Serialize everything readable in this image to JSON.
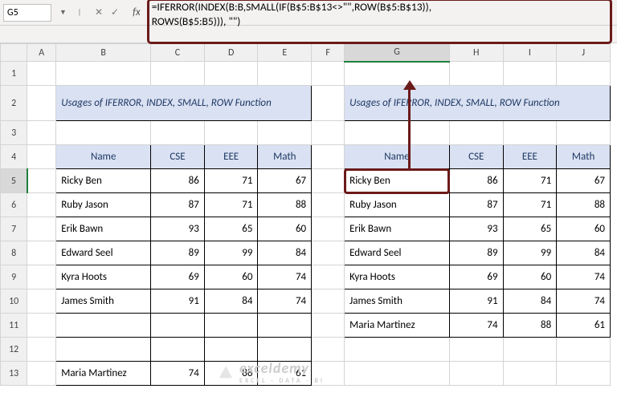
{
  "cell_ref": "G5",
  "fx_label": "fx",
  "formula": "=IFERROR(INDEX(B:B,SMALL(IF(B$5:B$13<>\"\",ROW(B$5:B$13)),\nROWS(B$5:B5))), \"\")",
  "columns": [
    "A",
    "B",
    "C",
    "D",
    "E",
    "F",
    "G",
    "H",
    "I",
    "J"
  ],
  "title": "Usages of IFERROR, INDEX, SMALL, ROW Function",
  "headers": [
    "Name",
    "CSE",
    "EEE",
    "Math"
  ],
  "left_rows": [
    {
      "name": "Ricky Ben",
      "cse": 86,
      "eee": 71,
      "math": 67
    },
    {
      "name": "Ruby Jason",
      "cse": 87,
      "eee": 71,
      "math": 88
    },
    {
      "name": "Erik Bawn",
      "cse": 93,
      "eee": 65,
      "math": 60
    },
    {
      "name": "Edward Seel",
      "cse": 89,
      "eee": 99,
      "math": 84
    },
    {
      "name": "Kyra Hoots",
      "cse": 69,
      "eee": 60,
      "math": 74
    },
    {
      "name": "James Smith",
      "cse": 91,
      "eee": 84,
      "math": 74
    },
    {
      "name": "",
      "cse": "",
      "eee": "",
      "math": ""
    },
    {
      "name": "",
      "cse": "",
      "eee": "",
      "math": ""
    },
    {
      "name": "Maria Martinez",
      "cse": 74,
      "eee": 88,
      "math": 61
    }
  ],
  "right_rows": [
    {
      "name": "Ricky Ben",
      "cse": 86,
      "eee": 71,
      "math": 67
    },
    {
      "name": "Ruby Jason",
      "cse": 87,
      "eee": 71,
      "math": 88
    },
    {
      "name": "Erik Bawn",
      "cse": 93,
      "eee": 65,
      "math": 60
    },
    {
      "name": "Edward Seel",
      "cse": 89,
      "eee": 99,
      "math": 84
    },
    {
      "name": "Kyra Hoots",
      "cse": 69,
      "eee": 60,
      "math": 74
    },
    {
      "name": "James Smith",
      "cse": 91,
      "eee": 84,
      "math": 74
    },
    {
      "name": "Maria Martinez",
      "cse": 74,
      "eee": 88,
      "math": 61
    }
  ],
  "watermark_main": "exceldemy",
  "watermark_sub": "EXCEL · DATA · BI"
}
